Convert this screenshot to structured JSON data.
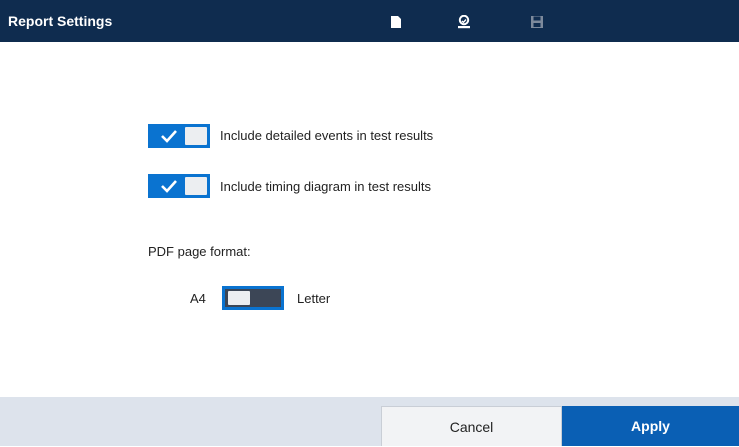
{
  "header": {
    "title": "Report Settings",
    "icons": [
      "document-icon",
      "certificate-icon",
      "save-icon"
    ]
  },
  "options": {
    "detailed_events": {
      "label": "Include detailed events in test results",
      "checked": true
    },
    "timing_diagram": {
      "label": "Include timing diagram in test results",
      "checked": true
    }
  },
  "pdf_format": {
    "heading": "PDF page format:",
    "left_label": "A4",
    "right_label": "Letter",
    "selected": "A4"
  },
  "footer": {
    "cancel_label": "Cancel",
    "apply_label": "Apply"
  },
  "colors": {
    "header_bg": "#0f2c4f",
    "accent": "#0a73d0",
    "apply_bg": "#0a5fb4",
    "footer_bg": "#dde3ec"
  }
}
